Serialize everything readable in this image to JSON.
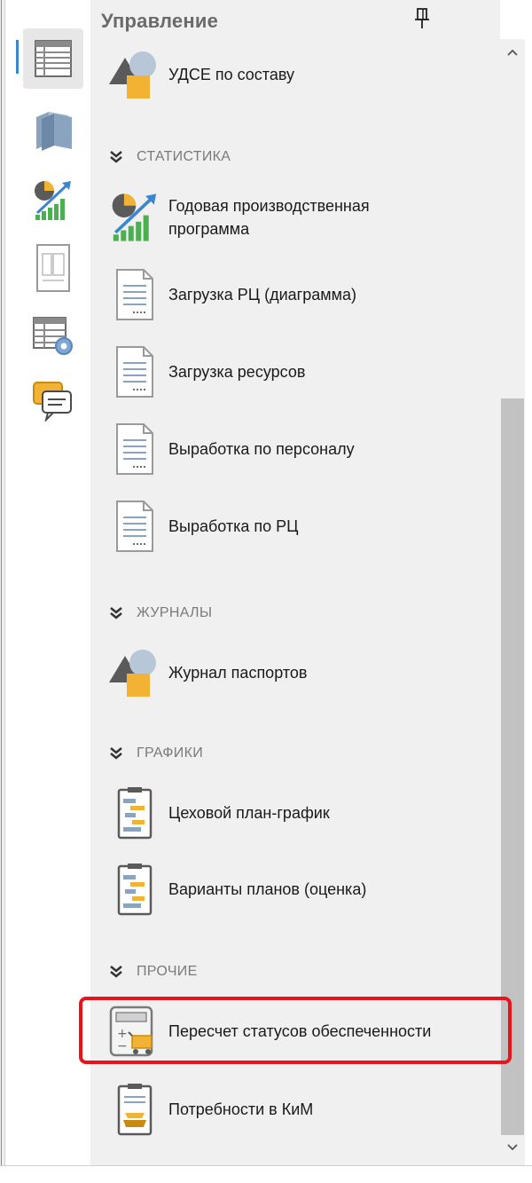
{
  "panel": {
    "title": "Управление"
  },
  "rail": {
    "items": [
      {
        "icon": "table-list-icon",
        "active": true
      },
      {
        "icon": "books-icon",
        "active": false
      },
      {
        "icon": "statistics-chart-icon",
        "active": false
      },
      {
        "icon": "document-page-icon",
        "active": false
      },
      {
        "icon": "table-settings-icon",
        "active": false
      },
      {
        "icon": "chat-messages-icon",
        "active": false
      }
    ]
  },
  "sections": {
    "statistics": "СТАТИСТИКА",
    "journals": "ЖУРНАЛЫ",
    "charts": "ГРАФИКИ",
    "other": "ПРОЧИЕ"
  },
  "items": {
    "udse": "УДСЕ по составу",
    "annual_program_line1": "Годовая производственная",
    "annual_program_line2": "программа",
    "load_rc": "Загрузка РЦ (диаграмма)",
    "load_resources": "Загрузка ресурсов",
    "output_personnel": "Выработка по персоналу",
    "output_rc": "Выработка по РЦ",
    "passport_journal": "Журнал паспортов",
    "shop_plan": "Цеховой план-график",
    "plan_variants": "Варианты планов (оценка)",
    "recalc_status": "Пересчет статусов обеспеченности",
    "needs_kim": "Потребности в КиМ"
  },
  "colors": {
    "highlight": "#e8141c",
    "accent": "#3b86d0",
    "shape_gray": "#5a5a5a",
    "shape_yellow": "#f2b233"
  }
}
